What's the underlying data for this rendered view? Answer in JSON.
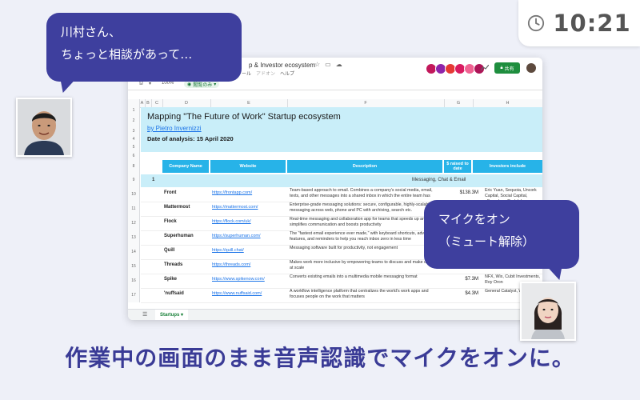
{
  "clock": {
    "time": "10:21",
    "icon": "clock-icon"
  },
  "sheet": {
    "doc_title": "p & Investor ecosystem",
    "menus": [
      "ータ",
      "ツール",
      "アドオン",
      "ヘルプ"
    ],
    "zoom": "100%",
    "view_only_label": "閲覧のみ",
    "share_label": "共有",
    "columns": [
      "A",
      "B",
      "C",
      "D",
      "E",
      "F",
      "G",
      "H"
    ],
    "row_numbers": [
      "1",
      "2",
      "3",
      "4",
      "5",
      "6",
      "7",
      "8",
      "9",
      "10",
      "11",
      "12",
      "13",
      "14",
      "15",
      "16",
      "17"
    ],
    "title": "Mapping \"The Future of Work\" Startup ecosystem",
    "byline": "by Pietro Invernizzi",
    "date": "Date of analysis: 15 April 2020",
    "headers": {
      "company": "Company Name",
      "website": "Website",
      "description": "Description",
      "raised": "$ raised to date",
      "investors": "Investors include"
    },
    "category": {
      "num": "1",
      "label": "Messaging, Chat & Email"
    },
    "rows": [
      {
        "name": "Front",
        "web": "https://frontapp.com/",
        "desc": "Team-based approach to email. Combines a company's social media, email, texts, and other messages into a shared inbox in which the entire team has",
        "raised": "$138.3M",
        "inv": "Eric Yuan, Sequoia, Uncork Capital, Social Capital, eFounders, Rodolphe"
      },
      {
        "name": "Mattermost",
        "web": "https://mattermost.com/",
        "desc": "Enterprise-grade messaging solutions: secure, configurable, highly-scalable messaging across web, phone and PC with archiving, search etc.",
        "raised": "",
        "inv": ""
      },
      {
        "name": "Flock",
        "web": "https://flock.com/uk/",
        "desc": "Real-time messaging and collaboration app for teams that speeds up and simplifies communication and boosts productivity",
        "raised": "",
        "inv": ""
      },
      {
        "name": "Superhuman",
        "web": "https://superhuman.com/",
        "desc": "The \"fastest email experience ever made,\" with keyboard shortcuts, advanced features, and reminders to help you reach inbox zero in less time",
        "raised": "",
        "inv": ""
      },
      {
        "name": "Quill",
        "web": "https://quill.chat/",
        "desc": "Messaging software built for productivity, not engagement",
        "raised": "",
        "inv": ""
      },
      {
        "name": "Threads",
        "web": "https://threads.com/",
        "desc": "Makes work more inclusive by empowering teams to discuss and make decisions at scale",
        "raised": "",
        "inv": ""
      },
      {
        "name": "Spike",
        "web": "https://www.spikenow.com/",
        "desc": "Converts existing emails into a multimedia mobile messaging format",
        "raised": "$7.3M",
        "inv": "NFX, Wix, Cubit Investments, Roy Oron"
      },
      {
        "name": "'nuffsaid",
        "web": "https://www.nuffsaid.com/",
        "desc": "A workflow intelligence platform that centralizes the world's work apps and focuses people on the work that matters",
        "raised": "$4.3M",
        "inv": "General Catalyst, Work"
      }
    ],
    "tab_label": "Startups"
  },
  "bubbles": {
    "left_line1": "川村さん、",
    "left_line2": "ちょっと相談があって…",
    "right_line1": "マイクをオン",
    "right_line2": "（ミュート解除）"
  },
  "caption": "作業中の画面のまま音声認識でマイクをオンに。",
  "colors": {
    "bubble": "#3e3f9e",
    "caption": "#3a3b96",
    "header_band": "#c9eef9",
    "table_header": "#27b3e8",
    "share": "#1e8e3e"
  }
}
